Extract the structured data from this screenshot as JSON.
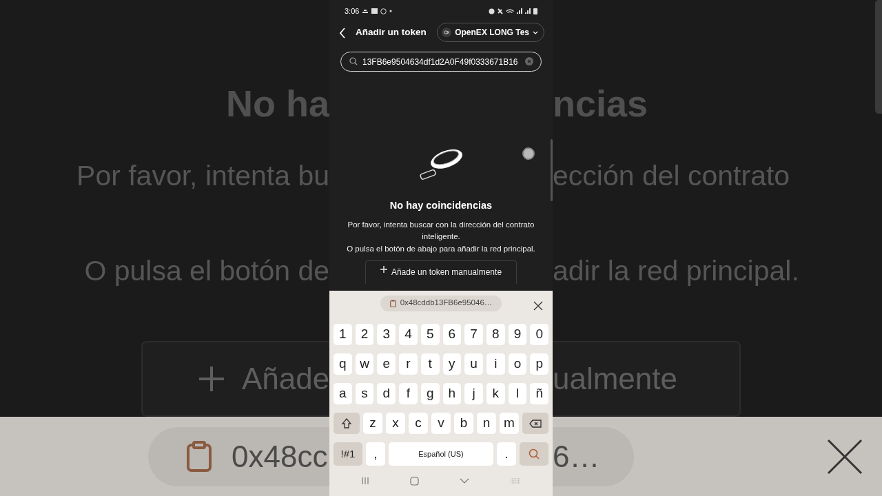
{
  "backdrop_rows": [
    {
      "kind": "title",
      "left": "No ha",
      "right": "ncias"
    },
    {
      "kind": "text",
      "left": "Por favor, intenta bu",
      "right": "ección del contrato"
    },
    {
      "kind": "text",
      "left": "O pulsa el botón de",
      "right": "adir la red principal."
    },
    {
      "kind": "button",
      "left": "Añade",
      "right": "ualmente"
    },
    {
      "kind": "clipboard",
      "left": "0x48cc",
      "right": "6…"
    }
  ],
  "status_bar": {
    "time": "3:06"
  },
  "header": {
    "title": "Añadir un token",
    "network": "OpenEX LONG Tes"
  },
  "search": {
    "value": "13FB6e9504634df1d2A0F49f0333671B16"
  },
  "empty_state": {
    "title": "No hay coincidencias",
    "lines": [
      "Por favor, intenta buscar con la dirección del contrato inteligente.",
      "O pulsa el botón de abajo para añadir la red principal."
    ]
  },
  "add_button": "Añade un token manualmente",
  "keyboard": {
    "clipboard": "0x48cddb13FB6e95046…",
    "rows": [
      {
        "keys": [
          {
            "kind": "char",
            "label": "1"
          },
          {
            "kind": "char",
            "label": "2"
          },
          {
            "kind": "char",
            "label": "3"
          },
          {
            "kind": "char",
            "label": "4"
          },
          {
            "kind": "char",
            "label": "5"
          },
          {
            "kind": "char",
            "label": "6"
          },
          {
            "kind": "char",
            "label": "7"
          },
          {
            "kind": "char",
            "label": "8"
          },
          {
            "kind": "char",
            "label": "9"
          },
          {
            "kind": "char",
            "label": "0"
          }
        ]
      },
      {
        "keys": [
          {
            "kind": "char",
            "label": "q"
          },
          {
            "kind": "char",
            "label": "w"
          },
          {
            "kind": "char",
            "label": "e"
          },
          {
            "kind": "char",
            "label": "r"
          },
          {
            "kind": "char",
            "label": "t"
          },
          {
            "kind": "char",
            "label": "y"
          },
          {
            "kind": "char",
            "label": "u"
          },
          {
            "kind": "char",
            "label": "i"
          },
          {
            "kind": "char",
            "label": "o"
          },
          {
            "kind": "char",
            "label": "p"
          }
        ]
      },
      {
        "keys": [
          {
            "kind": "char",
            "label": "a"
          },
          {
            "kind": "char",
            "label": "s"
          },
          {
            "kind": "char",
            "label": "d"
          },
          {
            "kind": "char",
            "label": "f"
          },
          {
            "kind": "char",
            "label": "g"
          },
          {
            "kind": "char",
            "label": "h"
          },
          {
            "kind": "char",
            "label": "j"
          },
          {
            "kind": "char",
            "label": "k"
          },
          {
            "kind": "char",
            "label": "l"
          },
          {
            "kind": "char",
            "label": "ñ"
          }
        ]
      },
      {
        "keys": [
          {
            "kind": "shift"
          },
          {
            "kind": "char",
            "label": "z"
          },
          {
            "kind": "char",
            "label": "x"
          },
          {
            "kind": "char",
            "label": "c"
          },
          {
            "kind": "char",
            "label": "v"
          },
          {
            "kind": "char",
            "label": "b"
          },
          {
            "kind": "char",
            "label": "n"
          },
          {
            "kind": "char",
            "label": "m"
          },
          {
            "kind": "backspace"
          }
        ]
      },
      {
        "keys": [
          {
            "kind": "symbols",
            "label": "!#1"
          },
          {
            "kind": "char",
            "label": ","
          },
          {
            "kind": "space",
            "label": "Español (US)"
          },
          {
            "kind": "char",
            "label": "."
          },
          {
            "kind": "search"
          }
        ]
      }
    ]
  }
}
